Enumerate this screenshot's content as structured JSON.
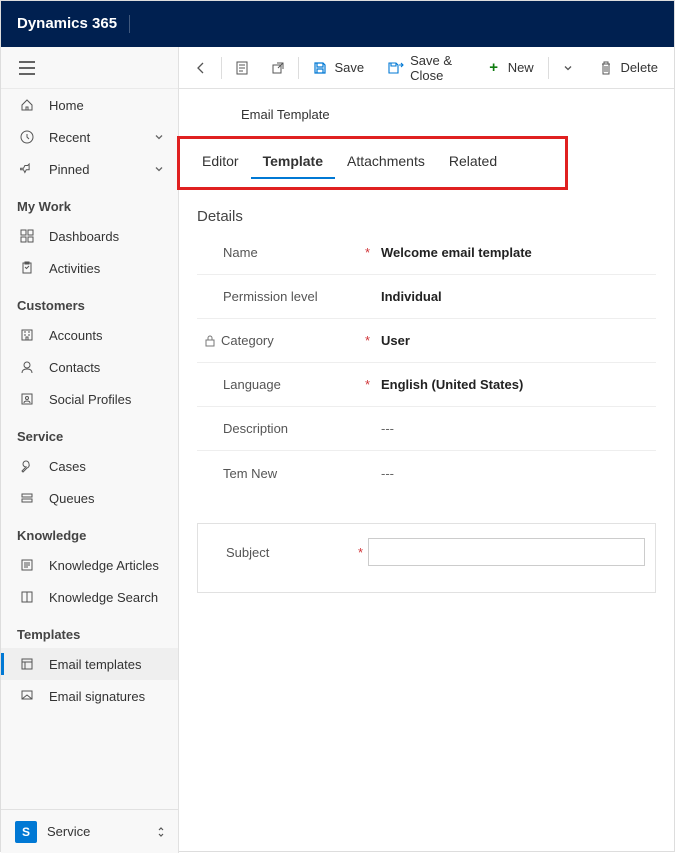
{
  "brand": "Dynamics 365",
  "nav": {
    "home": "Home",
    "recent": "Recent",
    "pinned": "Pinned",
    "groups": {
      "mywork": "My Work",
      "customers": "Customers",
      "service": "Service",
      "knowledge": "Knowledge",
      "templates": "Templates"
    },
    "dashboards": "Dashboards",
    "activities": "Activities",
    "accounts": "Accounts",
    "contacts": "Contacts",
    "social": "Social Profiles",
    "cases": "Cases",
    "queues": "Queues",
    "karticles": "Knowledge Articles",
    "ksearch": "Knowledge Search",
    "etemplates": "Email templates",
    "esignatures": "Email signatures"
  },
  "area": {
    "badge": "S",
    "label": "Service"
  },
  "cmd": {
    "save": "Save",
    "saveclose": "Save & Close",
    "new": "New",
    "delete": "Delete"
  },
  "form": {
    "entity": "Email Template",
    "tabs": {
      "editor": "Editor",
      "template": "Template",
      "attachments": "Attachments",
      "related": "Related"
    },
    "sections": {
      "details": "Details"
    },
    "fields": {
      "name": {
        "label": "Name",
        "required": "*",
        "value": "Welcome email template"
      },
      "permission": {
        "label": "Permission level",
        "required": "",
        "value": "Individual"
      },
      "category": {
        "label": "Category",
        "required": "*",
        "value": "User",
        "locked": true
      },
      "language": {
        "label": "Language",
        "required": "*",
        "value": "English (United States)"
      },
      "description": {
        "label": "Description",
        "required": "",
        "value": "---"
      },
      "temnew": {
        "label": "Tem New",
        "required": "",
        "value": "---"
      },
      "subject": {
        "label": "Subject",
        "required": "*",
        "value": ""
      }
    }
  }
}
